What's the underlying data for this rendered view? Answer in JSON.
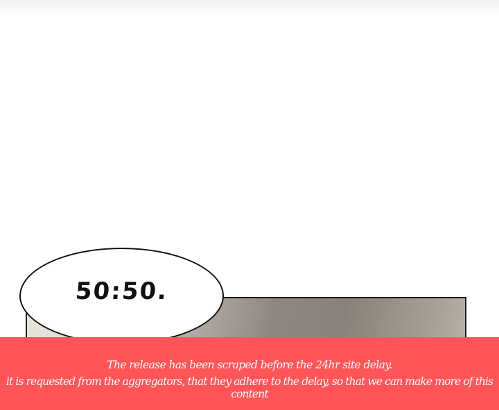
{
  "speech_bubble": {
    "text": "50:50."
  },
  "notice": {
    "line1": "The release has been scraped before the 24hr site delay.",
    "line2": "it is requested from the aggregators, that they adhere to the delay, so that we can make more of this content",
    "background_color": "#ff5558"
  }
}
